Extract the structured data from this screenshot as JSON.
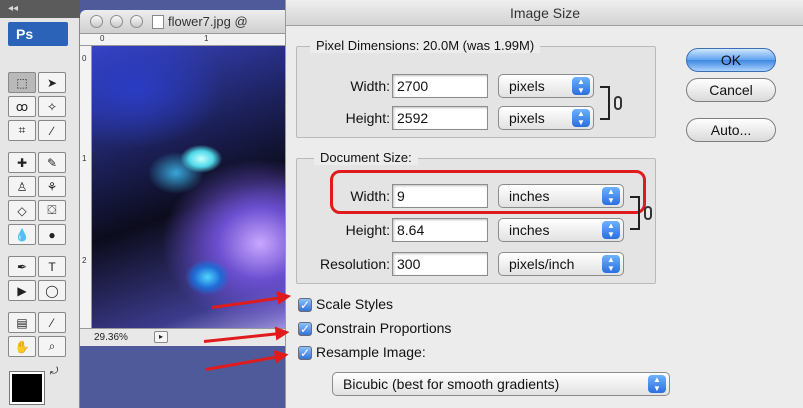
{
  "app": {
    "palette_label": "Ps"
  },
  "document": {
    "title": "flower7.jpg @",
    "zoom": "29.36%",
    "ruler_marks": [
      "0",
      "1",
      "2"
    ]
  },
  "dialog": {
    "title": "Image Size",
    "pixel_dimensions": {
      "legend": "Pixel Dimensions:  20.0M (was 1.99M)",
      "width_label": "Width:",
      "width_value": "2700",
      "width_unit": "pixels",
      "height_label": "Height:",
      "height_value": "2592",
      "height_unit": "pixels"
    },
    "document_size": {
      "legend": "Document Size:",
      "width_label": "Width:",
      "width_value": "9",
      "width_unit": "inches",
      "height_label": "Height:",
      "height_value": "8.64",
      "height_unit": "inches",
      "resolution_label": "Resolution:",
      "resolution_value": "300",
      "resolution_unit": "pixels/inch"
    },
    "buttons": {
      "ok": "OK",
      "cancel": "Cancel",
      "auto": "Auto..."
    },
    "options": {
      "scale_styles": "Scale Styles",
      "constrain_proportions": "Constrain Proportions",
      "resample_image": "Resample Image:",
      "resample_method": "Bicubic (best for smooth gradients)"
    }
  },
  "colors": {
    "highlight": "#e01b1b",
    "accent": "#3e87e0",
    "desktop": "#4f5a9a"
  }
}
